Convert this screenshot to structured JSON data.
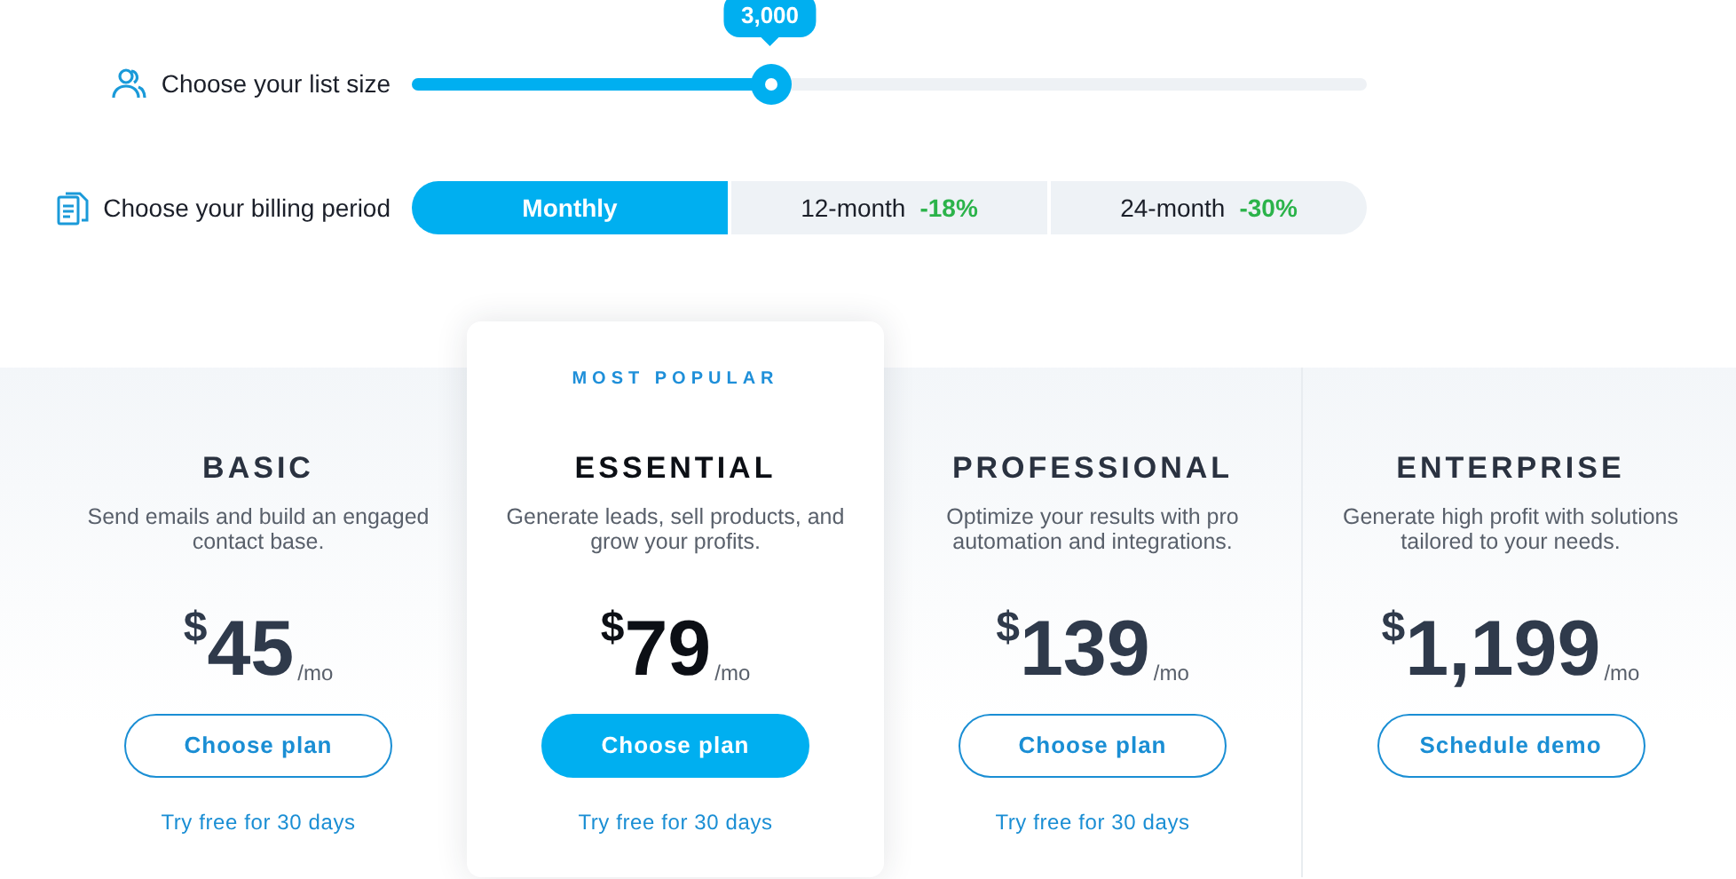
{
  "list_size": {
    "label": "Choose your list size",
    "value": "3,000",
    "level": 0.375
  },
  "billing_period": {
    "label": "Choose your billing period",
    "options": [
      {
        "label": "Monthly",
        "selected": true
      },
      {
        "label": "12-month",
        "discount": "-18%",
        "selected": false
      },
      {
        "label": "24-month",
        "discount": "-30%",
        "selected": false
      }
    ]
  },
  "plans": [
    {
      "name": "BASIC",
      "description": "Send emails and build an engaged contact base.",
      "currency": "$",
      "amount": "45",
      "period": "/mo",
      "button": {
        "label": "Choose plan",
        "primary": false
      },
      "trial": "Try free for 30 days",
      "featured": false
    },
    {
      "name": "ESSENTIAL",
      "badge": "MOST POPULAR",
      "description": "Generate leads, sell products, and grow your profits.",
      "currency": "$",
      "amount": "79",
      "period": "/mo",
      "button": {
        "label": "Choose plan",
        "primary": true
      },
      "trial": "Try free for 30 days",
      "featured": true
    },
    {
      "name": "PROFESSIONAL",
      "description": "Optimize your results with pro automation and integrations.",
      "currency": "$",
      "amount": "139",
      "period": "/mo",
      "button": {
        "label": "Choose plan",
        "primary": false
      },
      "trial": "Try free for 30 days",
      "featured": false
    },
    {
      "name": "ENTERPRISE",
      "description": "Generate high profit with solutions tailored to your needs.",
      "currency": "$",
      "amount": "1,199",
      "period": "/mo",
      "button": {
        "label": "Schedule demo",
        "primary": false
      },
      "featured": false
    }
  ]
}
